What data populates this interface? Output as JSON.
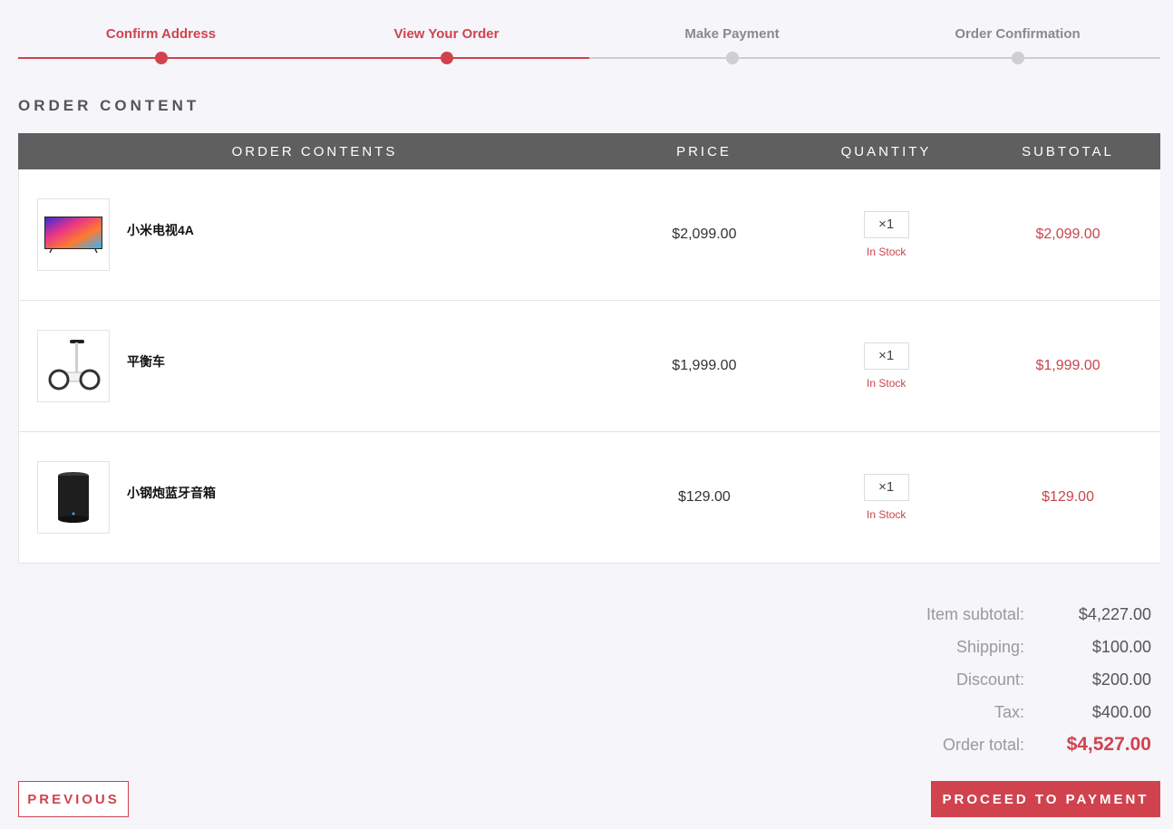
{
  "stepper": {
    "steps": [
      {
        "label": "Confirm Address",
        "state": "active"
      },
      {
        "label": "View Your Order",
        "state": "active"
      },
      {
        "label": "Make Payment",
        "state": "inactive"
      },
      {
        "label": "Order Confirmation",
        "state": "inactive"
      }
    ]
  },
  "section_title": "ORDER CONTENT",
  "table": {
    "headers": {
      "contents": "ORDER CONTENTS",
      "price": "PRICE",
      "quantity": "QUANTITY",
      "subtotal": "SUBTOTAL"
    },
    "rows": [
      {
        "name": "小米电视4A",
        "price": "$2,099.00",
        "quantity": "×1",
        "stock": "In Stock",
        "subtotal": "$2,099.00",
        "icon": "tv-icon"
      },
      {
        "name": "平衡车",
        "price": "$1,999.00",
        "quantity": "×1",
        "stock": "In Stock",
        "subtotal": "$1,999.00",
        "icon": "scooter-icon"
      },
      {
        "name": "小钢炮蓝牙音箱",
        "price": "$129.00",
        "quantity": "×1",
        "stock": "In Stock",
        "subtotal": "$129.00",
        "icon": "speaker-icon"
      }
    ]
  },
  "totals": {
    "item_subtotal_label": "Item subtotal:",
    "item_subtotal": "$4,227.00",
    "shipping_label": "Shipping:",
    "shipping": "$100.00",
    "discount_label": "Discount:",
    "discount": "$200.00",
    "tax_label": "Tax:",
    "tax": "$400.00",
    "order_total_label": "Order total:",
    "order_total": "$4,527.00"
  },
  "buttons": {
    "previous": "PREVIOUS",
    "proceed": "PROCEED TO PAYMENT"
  },
  "colors": {
    "accent": "#d0434e",
    "header_bg": "#5f5f5f",
    "inactive": "#cfcfcf",
    "page_bg": "#f5f5fa"
  }
}
